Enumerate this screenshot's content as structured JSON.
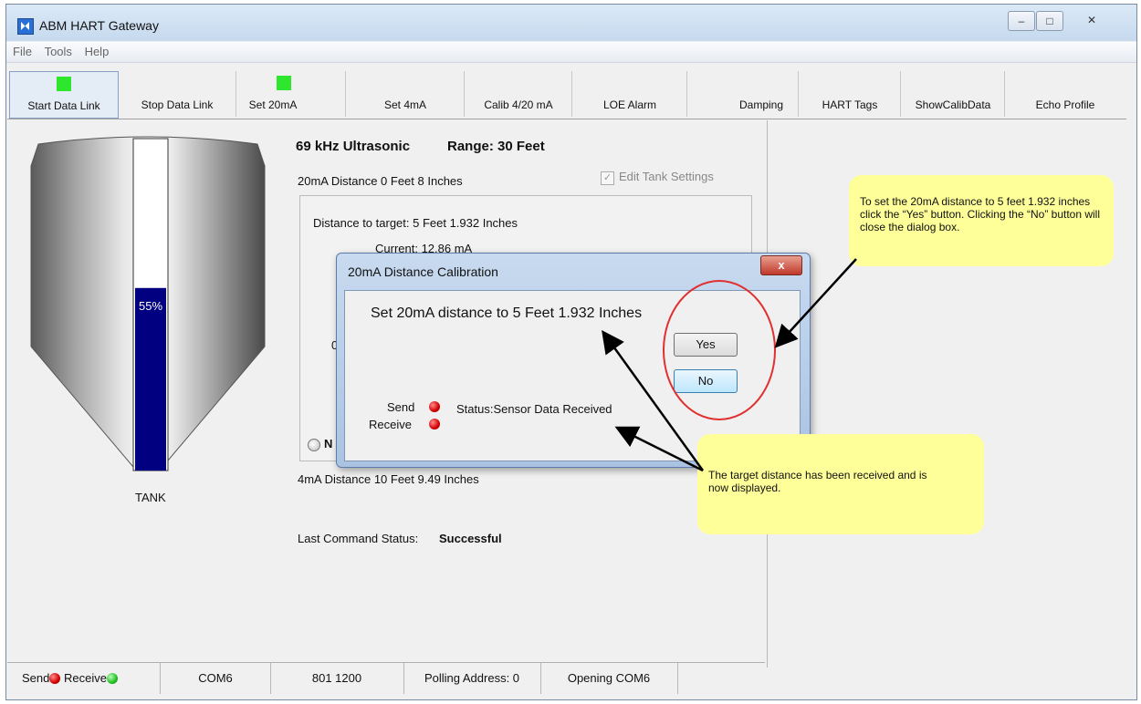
{
  "window": {
    "title": "ABM HART Gateway"
  },
  "menu": [
    "File",
    "Tools",
    "Help"
  ],
  "toolbar": [
    {
      "label": "Start Data Link",
      "led": true,
      "pressed": true
    },
    {
      "label": "Stop Data Link"
    },
    {
      "label": "Set 20mA",
      "led": true
    },
    {
      "label": "Set 4mA"
    },
    {
      "label": "Calib 4/20 mA"
    },
    {
      "label": "LOE Alarm"
    },
    {
      "label": "Damping"
    },
    {
      "label": "HART Tags"
    },
    {
      "label": "ShowCalibData"
    },
    {
      "label": "Echo Profile"
    }
  ],
  "tank": {
    "level_percent": 55,
    "level_label": "55%",
    "label": "TANK"
  },
  "sensor": {
    "header_freq": "69 kHz Ultrasonic",
    "header_range": "Range: 30 Feet",
    "distance_20ma": "20mA Distance 0 Feet 8 Inches",
    "edit_tank_settings": "Edit Tank Settings",
    "distance_to_target": "Distance to target: 5 Feet   1.932 Inches",
    "current": "Current: 12.86 mA",
    "partial_left": "0",
    "partial_radio": "N",
    "distance_4ma": "4mA Distance 10 Feet 9.49 Inches",
    "last_command_label": "Last Command Status:",
    "last_command_value": "Successful"
  },
  "dialog": {
    "title": "20mA Distance Calibration",
    "close": "x",
    "message": "Set 20mA distance to 5 Feet 1.932 Inches",
    "yes": "Yes",
    "no": "No",
    "send": "Send",
    "receive": "Receive",
    "status": "Status:Sensor Data Received"
  },
  "callouts": {
    "top": "To set the 20mA distance to 5 feet 1.932 inches click the “Yes” button. Clicking the “No” button will close the dialog box.",
    "bottom": "The target distance has been received and is now displayed."
  },
  "statusbar": {
    "send": "Send",
    "receive": "Receive",
    "port": "COM6",
    "baud": "801 1200",
    "polling": "Polling Address: 0",
    "state": "Opening COM6"
  },
  "colors": {
    "led_green": "#2ee62e",
    "tank_fill": "#000080",
    "callout": "#ffff9a",
    "highlight_circle": "#e03030"
  }
}
